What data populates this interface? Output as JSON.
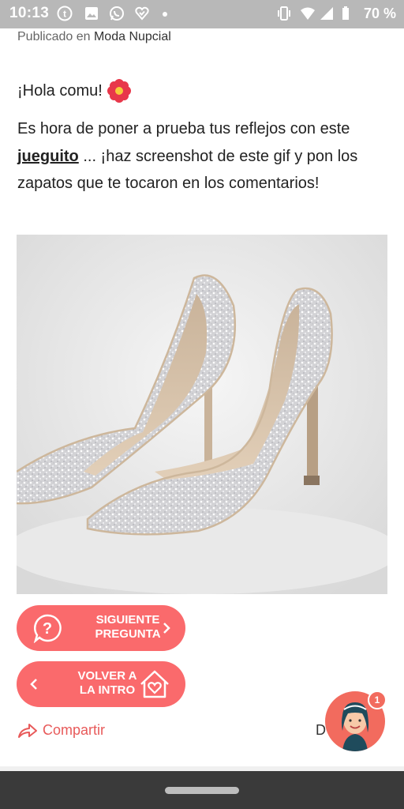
{
  "status_bar": {
    "time": "10:13",
    "battery": "70 %",
    "icons": [
      "tumblr-icon",
      "image-icon",
      "whatsapp-icon",
      "heart-check-icon",
      "vibrate-icon",
      "wifi-icon",
      "signal-icon",
      "battery-icon"
    ]
  },
  "article": {
    "published_prefix": "Publicado en",
    "category": "Moda Nupcial",
    "greeting": "¡Hola comu!",
    "body_part1": "Es hora de poner a prueba tus reflejos con este",
    "body_link": "jueguito",
    "body_part2": "... ¡haz screenshot de este gif y pon los zapatos que te tocaron en los comentarios!"
  },
  "buttons": {
    "next_question": "SIGUIENTE PREGUNTA",
    "back_intro": "VOLVER A LA INTRO"
  },
  "footer": {
    "share": "Compartir",
    "partial_text": "D",
    "notification_count": "1"
  },
  "colors": {
    "accent": "#fa6a6c",
    "status_bar": "#b8b8b8",
    "nav_bar": "#3a3a3a"
  }
}
